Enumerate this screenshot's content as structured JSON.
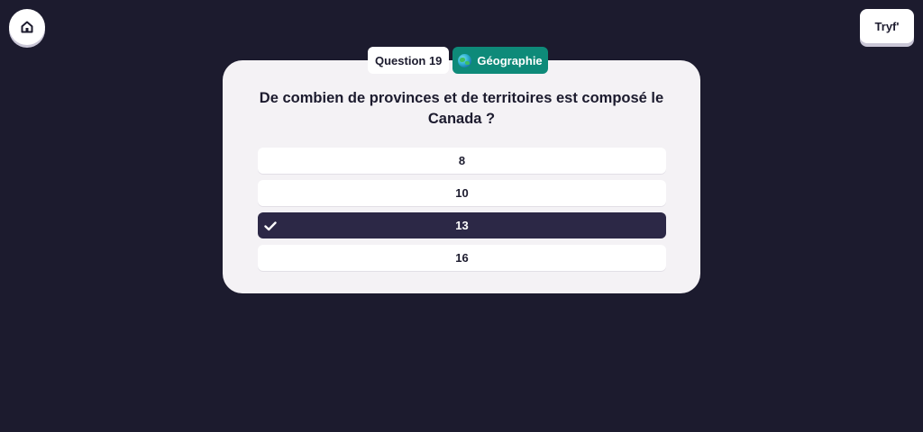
{
  "header": {
    "home_icon": "home-icon",
    "brand_label": "Tryf'"
  },
  "quiz": {
    "question_badge": "Question 19",
    "category": {
      "label": "Géographie",
      "icon": "globe-icon",
      "color": "#0e8a79"
    },
    "question": "De combien de provinces et de territoires est composé le Canada ?",
    "answers": [
      {
        "label": "8",
        "selected": false
      },
      {
        "label": "10",
        "selected": false
      },
      {
        "label": "13",
        "selected": true,
        "icon": "check-icon"
      },
      {
        "label": "16",
        "selected": false
      }
    ]
  },
  "colors": {
    "background": "#1c1b2e",
    "card": "#f4f2f5",
    "selected_answer": "#2c2846"
  }
}
